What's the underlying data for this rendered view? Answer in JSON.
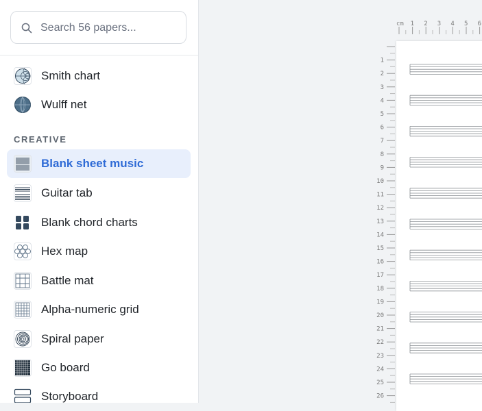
{
  "search": {
    "placeholder": "Search 56 papers..."
  },
  "sidebar": {
    "items_before": [
      {
        "label": "Smith chart",
        "icon": "smith-chart-icon"
      },
      {
        "label": "Wulff net",
        "icon": "wulff-net-icon"
      }
    ],
    "section_label": "CREATIVE",
    "items": [
      {
        "label": "Blank sheet music",
        "icon": "sheet-music-icon",
        "active": true
      },
      {
        "label": "Guitar tab",
        "icon": "guitar-tab-icon"
      },
      {
        "label": "Blank chord charts",
        "icon": "chord-chart-icon"
      },
      {
        "label": "Hex map",
        "icon": "hex-map-icon"
      },
      {
        "label": "Battle mat",
        "icon": "battle-mat-icon"
      },
      {
        "label": "Alpha-numeric grid",
        "icon": "alpha-numeric-grid-icon"
      },
      {
        "label": "Spiral paper",
        "icon": "spiral-icon"
      },
      {
        "label": "Go board",
        "icon": "go-board-icon"
      },
      {
        "label": "Storyboard",
        "icon": "storyboard-icon"
      }
    ]
  },
  "preview": {
    "ruler_unit": "cm",
    "h_ticks": [
      "1",
      "2",
      "3",
      "4",
      "5",
      "6"
    ],
    "v_ticks": [
      "1",
      "2",
      "3",
      "4",
      "5",
      "6",
      "7",
      "8",
      "9",
      "10",
      "11",
      "12",
      "13",
      "14",
      "15",
      "16",
      "17",
      "18",
      "19",
      "20",
      "21",
      "22",
      "23",
      "24",
      "25",
      "26"
    ],
    "staff_count": 11
  },
  "colors": {
    "accent": "#2f6bd6",
    "active_bg": "#e8effc"
  }
}
